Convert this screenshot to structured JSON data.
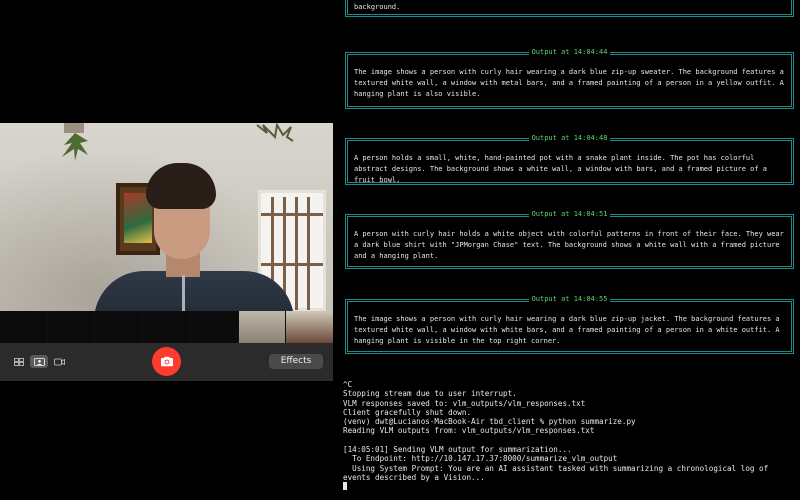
{
  "camera": {
    "effects_label": "Effects",
    "view_modes": [
      {
        "icon": "grid-view-icon",
        "selected": false
      },
      {
        "icon": "portrait-view-icon",
        "selected": true
      },
      {
        "icon": "video-camera-icon",
        "selected": false
      }
    ],
    "shutter_icon": "camera-icon",
    "shutter_color": "#ff3b30"
  },
  "terminal": {
    "panels": [
      {
        "title": "",
        "text": "describing the plot. The setting appears to be indoors, with a window and a plant visible in the background."
      },
      {
        "title": "Output at 14:04:44",
        "text": "The image shows a person with curly hair wearing a dark blue zip-up sweater. The background features a textured white wall, a window with metal bars, and a framed painting of a person in a yellow outfit. A hanging plant is also visible."
      },
      {
        "title": "Output at 14:04:48",
        "text": "A person holds a small, white, hand-painted pot with a snake plant inside. The pot has colorful abstract designs. The background shows a white wall, a window with bars, and a framed picture of a fruit bowl."
      },
      {
        "title": "Output at 14:04:51",
        "text": "A person with curly hair holds a white object with colorful patterns in front of their face. They wear a dark blue shirt with \"JPMorgan Chase\" text. The background shows a white wall with a framed picture and a hanging plant."
      },
      {
        "title": "Output at 14:04:55",
        "text": "The image shows a person with curly hair wearing a dark blue zip-up jacket. The background features a textured white wall, a window with white bars, and a framed painting of a person in a white outfit. A hanging plant is visible in the top right corner."
      }
    ],
    "console_lines": [
      "^C",
      "Stopping stream due to user interrupt.",
      "VLM responses saved to: vlm_outputs/vlm_responses.txt",
      "Client gracefully shut down.",
      "(venv) dwt@Lucianos-MacBook-Air tbd_client % python summarize.py",
      "Reading VLM outputs from: vlm_outputs/vlm_responses.txt",
      "",
      "[14:05:01] Sending VLM output for summarization...",
      "  To Endpoint: http://10.147.17.37:8000/summarize_vlm_output",
      "  Using System Prompt: You are an AI assistant tasked with summarizing a chronological log of",
      "events described by a Vision..."
    ],
    "border_color": "#1f8a8a",
    "title_color": "#58d668"
  }
}
